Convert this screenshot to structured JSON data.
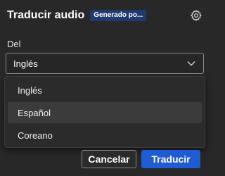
{
  "header": {
    "title": "Traducir audio",
    "ai_badge": "Generado po..."
  },
  "icons": {
    "settings": "gear-icon",
    "dropdown": "chevron-down-icon"
  },
  "form": {
    "from_label": "Del",
    "from_selected": "Inglés",
    "options": [
      "Inglés",
      "Español",
      "Coreano"
    ],
    "hovered_option": "Español"
  },
  "footer": {
    "cancel_label": "Cancelar",
    "translate_label": "Traducir"
  },
  "colors": {
    "background": "#282828",
    "accent": "#1f5bd1",
    "badge": "#1f3a6e"
  }
}
